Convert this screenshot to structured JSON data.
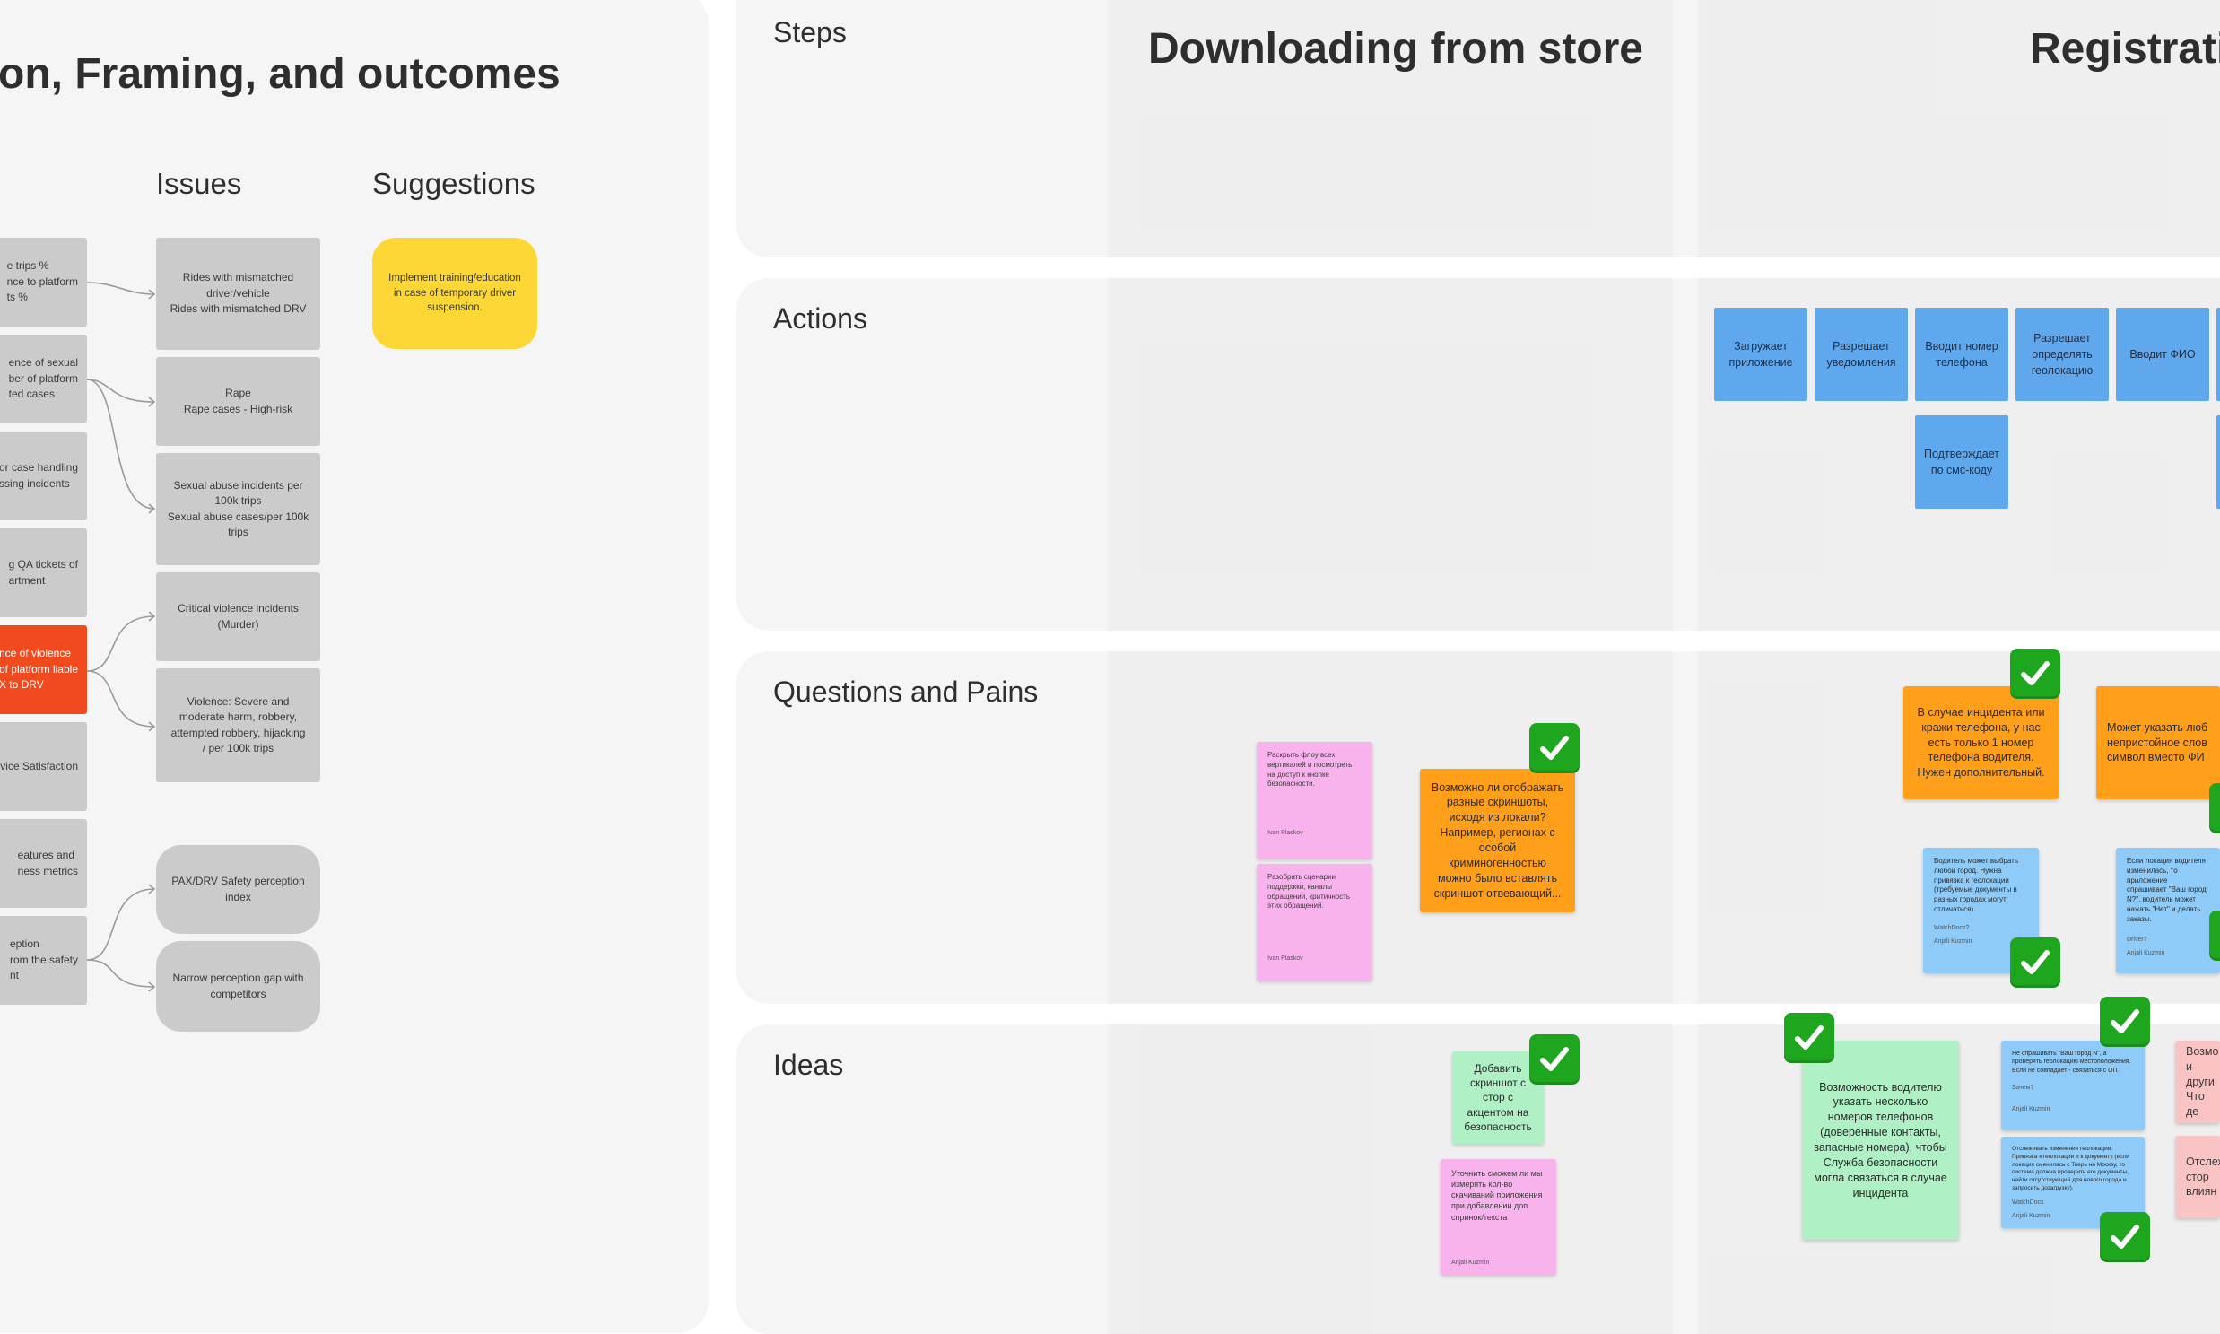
{
  "left_panel": {
    "title": "on, Framing, and outcomes",
    "issues_header": "Issues",
    "suggestions_header": "Suggestions",
    "metric_cards": [
      "e trips %\nnce to platform\nts %",
      "ence of sexual\nber of platform\nted cases",
      "or case handling\nssing incidents",
      "g QA tickets of\nartment",
      "nce of violence\nof platform liable\nX to DRV",
      "vice Satisfaction",
      "eatures and\nness metrics",
      "eption\nrom the safety\nnt"
    ],
    "issue_cards": [
      "Rides with mismatched\ndriver/vehicle\nRides with mismatched DRV",
      "Rape\nRape cases - High-risk",
      "Sexual abuse incidents per\n100k trips\nSexual abuse cases/per 100k\ntrips",
      "Critical violence incidents\n(Murder)",
      "Violence: Severe and\nmoderate harm, robbery,\nattempted robbery, hijacking\n/ per 100k trips",
      "PAX/DRV Safety perception\nindex",
      "Narrow perception gap with\ncompetitors"
    ],
    "suggestion": "Implement training/education\nin case of temporary driver\nsuspension.",
    "colors": {
      "highlight": "#f04a1e",
      "suggestion": "#fdd735",
      "card": "#cbcbcb"
    }
  },
  "journey_map": {
    "rows": {
      "steps": "Steps",
      "actions": "Actions",
      "questions": "Questions and Pains",
      "ideas": "Ideas"
    },
    "step_titles": [
      "Downloading from store",
      "Registrati"
    ],
    "actions": [
      "Загружает\nприложение",
      "Разрешает\nуведомления",
      "Вводит номер\nтелефона",
      "Разрешает\nопределять\nгеолокацию",
      "Вводит ФИО",
      "Подтверждает\nпо смс-коду"
    ],
    "questions": {
      "pink_1": {
        "text": "Раскрыть флоу всех вертикалей и посмотреть на доступ к кнопке безопасности.",
        "author": "Ivan Plaskov"
      },
      "pink_2": {
        "text": "Разобрать сценарии поддержки, каналы обращений, критичность этих обращений.",
        "author": "Ivan Plaskov"
      },
      "orange_1": "Возможно ли отображать разные скриншоты, исходя из локали? Например, регионах с особой криминогенностью можно было вставлять скриншот отвевающий...",
      "orange_2": "В случае инцидента или кражи телефона, у нас есть только 1 номер телефона водителя. Нужен дополнительный.",
      "orange_3": "Может указать люб непристойное слов символ вместо ФИ",
      "blue_1": {
        "text": "Водитель может выбрать любой город. Нужна привязка к геолокации (требуемые документы в разных городах могут отличаться).",
        "extra": "WatchDocs?",
        "author": "Anjali Kuzmin"
      },
      "blue_2": {
        "text": "Если локация водителя изменилась, то приложение спрашивает \"Ваш город N?\", водитель может нажать \"Нет\" и делать заказы.",
        "extra": "Driver?",
        "author": "Anjali Kuzmin"
      }
    },
    "ideas": {
      "green_1": "Добавить скриншот с стор с акцентом на безопасность",
      "pink_1": {
        "text": "Уточнить сможем ли мы измерять кол-во скачиваний приложения при добавлении доп спринок/текста",
        "author": "Anjali Kuzmin"
      },
      "green_2": "Возможность водителю указать несколько номеров телефонов (доверенные контакты, запасные номера), чтобы Служба безопасности могла связаться в случае инцидента",
      "blue_1": {
        "text": "Не спрашивать \"Ваш город N\", а проверять геолокацию местоположения. Если не совпадает - связаться с ОП.",
        "extra": "Зачем?",
        "author": "Anjali Kuzmin"
      },
      "blue_2": {
        "text": "Отслеживать изменения геолокации. Привязка к геолокации и к документу (если локация сменилась с Тверь на Москву, то система должна проверить его документы, найти отсутствующий для нового города и запросить дозагрузку).",
        "extra": "WatchDocs",
        "author": "Anjali Kuzmin"
      },
      "pink_2": "Возмо и други Что де",
      "pink_3": "Отслеж стор влиян"
    },
    "colors": {
      "orange": "#ff9f1a",
      "pink": "#f9b3ec",
      "green": "#aff0c5",
      "blue": "#8ecbf9",
      "action": "#5fa8ee",
      "check": "#1fa61f"
    },
    "icons": [
      "check-mark-icon"
    ]
  }
}
